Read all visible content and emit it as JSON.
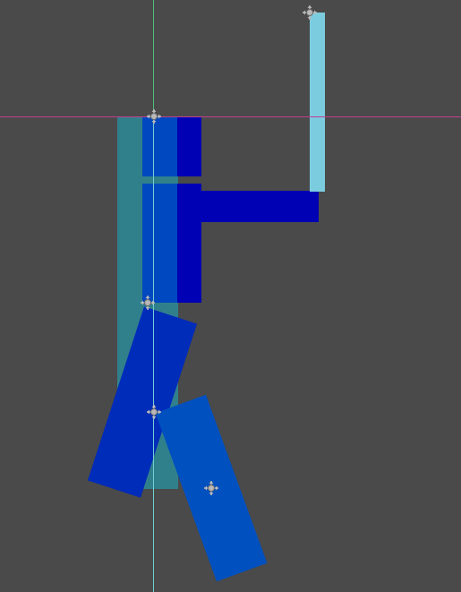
{
  "viewport": {
    "background": "#4a4a4a",
    "x_axis_color": "#c0408f",
    "y_axis_color": "#4fc07a"
  },
  "colors": {
    "body_dark": "#0000b4",
    "body_mid": "#0050c0",
    "bone_teal": "#2b8a98",
    "arm_light": "#7cccdf",
    "handle": "#b8b8b8"
  },
  "icons": {
    "pivot_handle": "move-cross-icon"
  }
}
